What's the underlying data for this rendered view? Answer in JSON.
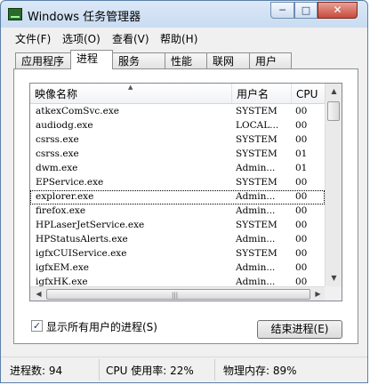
{
  "window": {
    "title": "Windows 任务管理器",
    "controls": {
      "minimize": "─",
      "maximize": "□",
      "close": "✕"
    }
  },
  "menu": [
    "文件(F)",
    "选项(O)",
    "查看(V)",
    "帮助(H)"
  ],
  "tabs": [
    {
      "label": "应用程序",
      "active": false
    },
    {
      "label": "进程",
      "active": true
    },
    {
      "label": "服务",
      "active": false
    },
    {
      "label": "性能",
      "active": false
    },
    {
      "label": "联网",
      "active": false
    },
    {
      "label": "用户",
      "active": false
    }
  ],
  "table": {
    "columns": [
      "映像名称",
      "用户名",
      "CPU"
    ],
    "sort_indicator": "▲",
    "rows": [
      {
        "name": "atkexComSvc.exe",
        "user": "SYSTEM",
        "cpu": "00"
      },
      {
        "name": "audiodg.exe",
        "user": "LOCAL...",
        "cpu": "00"
      },
      {
        "name": "csrss.exe",
        "user": "SYSTEM",
        "cpu": "00"
      },
      {
        "name": "csrss.exe",
        "user": "SYSTEM",
        "cpu": "01"
      },
      {
        "name": "dwm.exe",
        "user": "Admin...",
        "cpu": "01"
      },
      {
        "name": "EPService.exe",
        "user": "SYSTEM",
        "cpu": "00"
      },
      {
        "name": "explorer.exe",
        "user": "Admin...",
        "cpu": "00",
        "selected": true
      },
      {
        "name": "firefox.exe",
        "user": "Admin...",
        "cpu": "00"
      },
      {
        "name": "HPLaserJetService.exe",
        "user": "SYSTEM",
        "cpu": "00"
      },
      {
        "name": "HPStatusAlerts.exe",
        "user": "Admin...",
        "cpu": "00"
      },
      {
        "name": "igfxCUIService.exe",
        "user": "SYSTEM",
        "cpu": "00"
      },
      {
        "name": "igfxEM.exe",
        "user": "Admin...",
        "cpu": "00"
      },
      {
        "name": "igfxHK.exe",
        "user": "Admin...",
        "cpu": "00"
      }
    ],
    "scroll": {
      "up": "▲",
      "down": "▼",
      "left": "◀",
      "right": "▶",
      "grip": "|||"
    }
  },
  "show_all_users": {
    "label": "显示所有用户的进程(S)",
    "checked": true,
    "check_glyph": "✓"
  },
  "end_process_button": "结束进程(E)",
  "status": {
    "processes": "进程数: 94",
    "cpu": "CPU 使用率: 22%",
    "memory": "物理内存: 89%"
  }
}
